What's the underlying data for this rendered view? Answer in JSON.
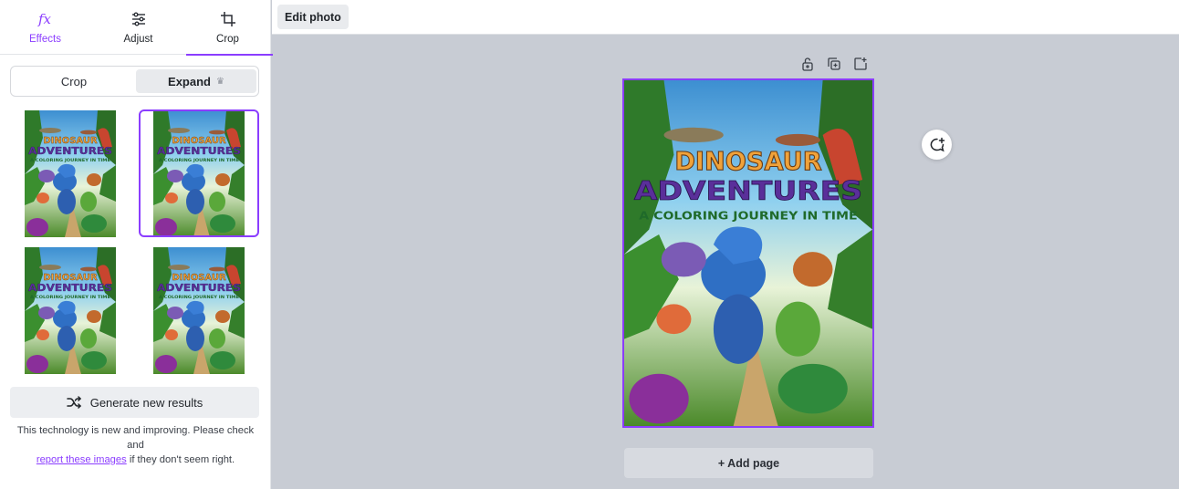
{
  "tabs": [
    {
      "label": "Effects",
      "icon": "fx-icon",
      "active": false
    },
    {
      "label": "Adjust",
      "icon": "sliders-icon",
      "active": false
    },
    {
      "label": "Crop",
      "icon": "crop-icon",
      "active": true
    }
  ],
  "segment": {
    "crop_label": "Crop",
    "expand_label": "Expand",
    "expand_badge": "crown-icon",
    "selected": "Expand"
  },
  "results": [
    {
      "title": "DINOSAUR",
      "title2": "ADVENTURES",
      "subtitle": "A COLORING JOURNEY IN TIME",
      "selected": false
    },
    {
      "title": "DINOSAUR",
      "title2": "ADVENTURES",
      "subtitle": "A COLORING JOURNEY IN TIME",
      "selected": true
    },
    {
      "title": "DINOSAUR",
      "title2": "ADVENTURES",
      "subtitle": "A COLORING JOURNEY IN TIME",
      "selected": false
    },
    {
      "title": "DINOSAUR",
      "title2": "ADVENTURES",
      "subtitle": "A COLORING JOURNEY IN TIME",
      "selected": false
    }
  ],
  "generate_label": "Generate new results",
  "note": {
    "prefix": "This technology is new and improving. Please check and",
    "link": "report these images",
    "suffix": "if they don't seem right."
  },
  "topbar": {
    "edit_photo_label": "Edit photo"
  },
  "canvas": {
    "cover": {
      "title": "DINOSAUR",
      "title2": "ADVENTURES",
      "subtitle": "A COLORING JOURNEY IN TIME"
    },
    "add_page_label": "+ Add page",
    "tools": [
      "lock-icon",
      "duplicate-icon",
      "add-page-icon"
    ]
  },
  "colors": {
    "accent": "#8b3dff",
    "canvas_bg": "#c8ccd4"
  }
}
